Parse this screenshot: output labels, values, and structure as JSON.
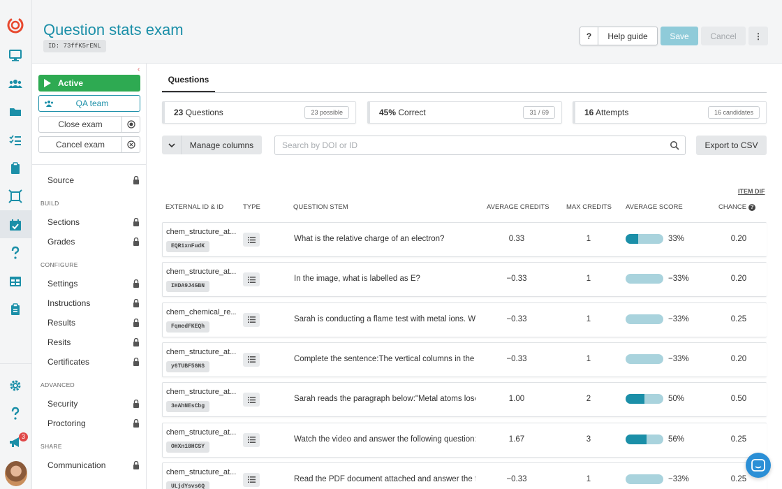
{
  "header": {
    "title": "Question stats exam",
    "exam_id": "ID: 73ffK5rENL",
    "help_q": "?",
    "help_label": "Help guide",
    "save_label": "Save",
    "cancel_label": "Cancel",
    "more_label": "⋮"
  },
  "rail": {
    "notification_count": "3",
    "icons": [
      "logo-icon",
      "monitor-icon",
      "users-icon",
      "folder-icon",
      "checklist-icon",
      "clipboard-icon",
      "frame-icon",
      "calendar-check-icon",
      "help-icon",
      "table-icon",
      "clipboard-list-icon",
      "settings-icon",
      "help-icon",
      "megaphone-icon"
    ]
  },
  "sidebar": {
    "status_label": "Active",
    "team_label": "QA team",
    "close_exam_label": "Close exam",
    "cancel_exam_label": "Cancel exam",
    "source_label": "Source",
    "groups": {
      "build": "BUILD",
      "configure": "CONFIGURE",
      "advanced": "ADVANCED",
      "share": "SHARE"
    },
    "items": {
      "sections": "Sections",
      "grades": "Grades",
      "settings": "Settings",
      "instructions": "Instructions",
      "results": "Results",
      "resits": "Resits",
      "certificates": "Certificates",
      "security": "Security",
      "proctoring": "Proctoring",
      "communication": "Communication"
    }
  },
  "main": {
    "tab_label": "Questions",
    "stats": [
      {
        "value": "23",
        "label": " Questions",
        "pill": "23 possible"
      },
      {
        "value": "45%",
        "label": " Correct",
        "pill": "31 / 69"
      },
      {
        "value": "16",
        "label": " Attempts",
        "pill": "16 candidates"
      }
    ],
    "manage_columns_label": "Manage columns",
    "search_placeholder": "Search by DOI or ID",
    "export_label": "Export to CSV",
    "item_dif_label": "ITEM DIF",
    "columns": {
      "ext_id": "EXTERNAL ID & ID",
      "type": "TYPE",
      "stem": "QUESTION STEM",
      "avg_credits": "AVERAGE CREDITS",
      "max_credits": "MAX CREDITS",
      "avg_score": "AVERAGE SCORE",
      "chance": "CHANCE"
    },
    "rows": [
      {
        "ext": "chem_structure_at...",
        "id": "EQR1xnFudK",
        "stem": "What is the relative charge of an electron?",
        "avg": "0.33",
        "max": "1",
        "score": 33,
        "score_label": "33%",
        "chance": "0.20"
      },
      {
        "ext": "chem_structure_at...",
        "id": "IHDA9J4GBN",
        "stem": "In the image, what is labelled as E?",
        "avg": "−0.33",
        "max": "1",
        "score": 0,
        "score_label": "−33%",
        "chance": "0.20"
      },
      {
        "ext": "chem_chemical_re...",
        "id": "FqmedFKEQh",
        "stem": "Sarah is conducting a flame test with metal ions. Whi...",
        "avg": "−0.33",
        "max": "1",
        "score": 0,
        "score_label": "−33%",
        "chance": "0.25"
      },
      {
        "ext": "chem_structure_at...",
        "id": "y6TUBF5GNS",
        "stem": "Complete the sentence:The vertical columns in the p...",
        "avg": "−0.33",
        "max": "1",
        "score": 0,
        "score_label": "−33%",
        "chance": "0.20"
      },
      {
        "ext": "chem_structure_at...",
        "id": "3eAhNEsCbg",
        "stem": "Sarah reads the paragraph below:\"Metal atoms lose ...",
        "avg": "1.00",
        "max": "2",
        "score": 50,
        "score_label": "50%",
        "chance": "0.50"
      },
      {
        "ext": "chem_structure_at...",
        "id": "OHXn18HCSY",
        "stem": "Watch the video and answer the following question: ...",
        "avg": "1.67",
        "max": "3",
        "score": 56,
        "score_label": "56%",
        "chance": "0.25"
      },
      {
        "ext": "chem_structure_at...",
        "id": "ULjdYsvs6Q",
        "stem": "Read the PDF document attached and answer the fo...",
        "avg": "−0.33",
        "max": "1",
        "score": 0,
        "score_label": "−33%",
        "chance": "0.25"
      }
    ]
  },
  "colors": {
    "brand_teal": "#1b8fa8",
    "active_green": "#2eaa52",
    "bar_track": "#a9d3dd",
    "logo_red": "#e8492f",
    "notif_red": "#e04848",
    "chat_blue": "#2b8fd6"
  }
}
